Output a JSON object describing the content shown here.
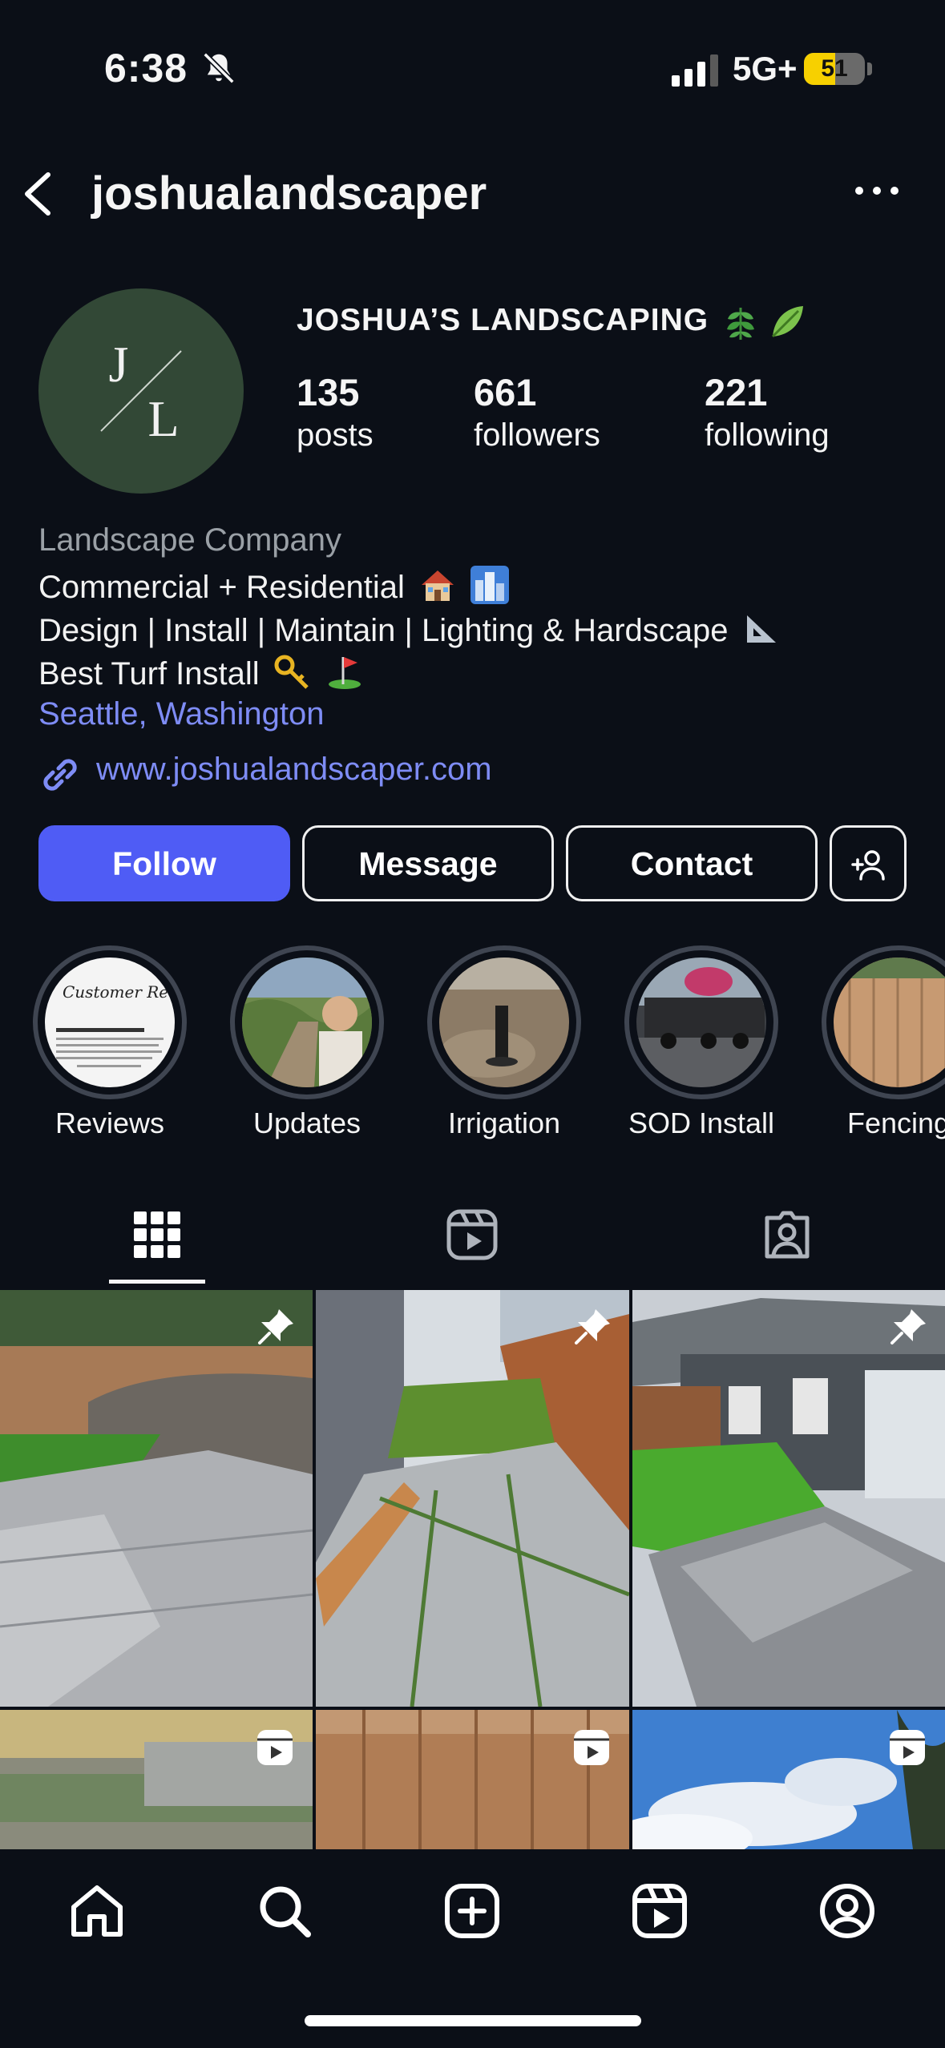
{
  "status_bar": {
    "time": "6:38",
    "network": "5G+",
    "battery_level": "51",
    "battery_fraction": 0.51
  },
  "header": {
    "username": "joshualandscaper"
  },
  "profile": {
    "avatar_text_top": "J",
    "avatar_text_bottom": "L",
    "display_name": "JOSHUA’S LANDSCAPING",
    "stats": [
      {
        "value": "135",
        "label": "posts"
      },
      {
        "value": "661",
        "label": "followers"
      },
      {
        "value": "221",
        "label": "following"
      }
    ],
    "category": "Landscape Company",
    "bio_lines": [
      "Commercial + Residential",
      "Design | Install | Maintain | Lighting & Hardscape",
      "Best Turf Install"
    ],
    "location": "Seattle, Washington",
    "website": "www.joshualandscaper.com"
  },
  "actions": {
    "follow": "Follow",
    "message": "Message",
    "contact": "Contact"
  },
  "highlights": [
    {
      "label": "Reviews",
      "card_title": "Customer Review"
    },
    {
      "label": "Updates"
    },
    {
      "label": "Irrigation"
    },
    {
      "label": "SOD Install"
    },
    {
      "label": "Fencing"
    }
  ],
  "icons": {
    "back": "chevron-left-icon",
    "more": "more-horizontal-icon",
    "link": "link-icon",
    "add_user": "add-user-icon",
    "grid_tab": "grid-icon",
    "reels_tab": "reels-icon",
    "tagged_tab": "tagged-icon",
    "pin": "pin-icon",
    "home": "home-icon",
    "search": "search-icon",
    "create": "create-icon",
    "profile": "profile-icon"
  },
  "colors": {
    "background": "#0b0f17",
    "accent": "#4f5cf5",
    "link": "#7e8cf5",
    "avatar": "#324836",
    "battery": "#f7d000"
  }
}
